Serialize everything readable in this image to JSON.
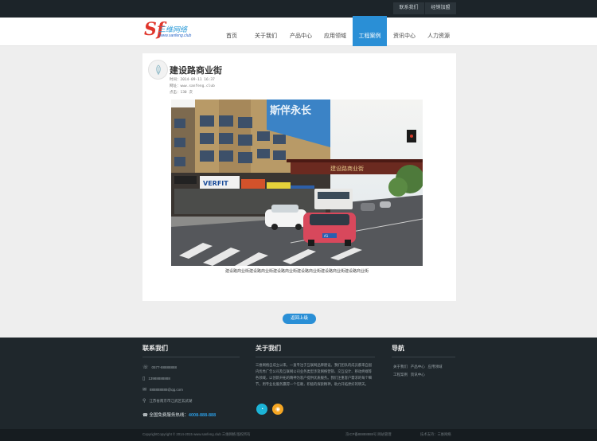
{
  "topbar": {
    "contact_label": "联系我们",
    "franchise_label": "经销加盟"
  },
  "logo": {
    "cn": "三维网络",
    "url": "www.sanfeng.club"
  },
  "nav": {
    "items": [
      {
        "label": "首页"
      },
      {
        "label": "关于我们"
      },
      {
        "label": "产品中心"
      },
      {
        "label": "应用领域"
      },
      {
        "label": "工程案例"
      },
      {
        "label": "资讯中心"
      },
      {
        "label": "人力资源"
      }
    ],
    "active_index": 4
  },
  "article": {
    "title": "建设路商业街",
    "time": "时间：2014-09-11 16:37",
    "url": "网址：www.sanfeng.club",
    "views": "点击：130 次",
    "caption": "建设路商业街建设路商业街建设路商业街建设路商业街建设路商业街建设路商业街",
    "photo_signs": {
      "banner": "斯伴永长",
      "gate": "建设路商业街",
      "verfit": "VERFIT",
      "plate": "A1"
    }
  },
  "back_button": {
    "label": "返回上级"
  },
  "footer": {
    "contact": {
      "title": "联系我们",
      "phone": "0577-88888888",
      "mobile": "13988888888",
      "email": "888888888@qq.com",
      "address": "江苏省南京市江武区玄武湖",
      "hotline_label": "全国免费服务热线：",
      "hotline_number": "4008-888-888"
    },
    "about": {
      "title": "关于我们",
      "text": "三维网络自成立以来，一直专注于互联网品牌建设。我们团队的成员都来自国内优秀广告公司及互联网公司业务类型涉及网络营销、交互设计、移动终端等各领域，以创新开拓的精神为客户提供优质服务。我们注重客户需求的每个细节，用专业化服务赢得一个信赖，积极的探索精神，助力开拓更好的明天。"
    },
    "nav": {
      "title": "导航",
      "links_row1": [
        "关于我们",
        "产品中心",
        "应用领域"
      ],
      "links_row2": [
        "工程案例",
        "资讯中心"
      ]
    }
  },
  "bottom": {
    "copyright": "CopyrightCopyright © 2014-2015 www.sanfeng.club 三维网络 版权所有",
    "icp": "京ICP备88888888号 网站管理",
    "tech": "技术支持：三维网络"
  },
  "colors": {
    "accent": "#2a8fd6",
    "footer_bg": "#1f272c",
    "topbar_bg": "#1c2429",
    "qq": "#1cb4d7",
    "weibo": "#f5a623"
  }
}
